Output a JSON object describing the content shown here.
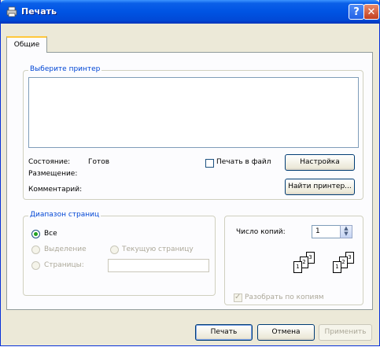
{
  "window": {
    "title": "Печать"
  },
  "tabs": {
    "general": "Общие"
  },
  "printer_group": {
    "legend": "Выберите принтер",
    "status_label": "Состояние:",
    "status_value": "Готов",
    "location_label": "Размещение:",
    "comment_label": "Комментарий:",
    "print_to_file": "Печать в файл",
    "settings_button": "Настройка",
    "find_printer_button": "Найти принтер..."
  },
  "page_range": {
    "legend": "Диапазон страниц",
    "all": "Все",
    "selection": "Выделение",
    "current_page": "Текущую страницу",
    "pages": "Страницы:",
    "selected": "all"
  },
  "copies": {
    "label": "Число копий:",
    "value": "1",
    "collate_label": "Разобрать по копиям",
    "collate_checked": true,
    "page_numbers": [
      "1",
      "2",
      "3"
    ]
  },
  "buttons": {
    "print": "Печать",
    "cancel": "Отмена",
    "apply": "Применить"
  },
  "colors": {
    "title_bar": "#0054e3",
    "legend_text": "#0046d5",
    "dialog_bg": "#ece9d8"
  }
}
